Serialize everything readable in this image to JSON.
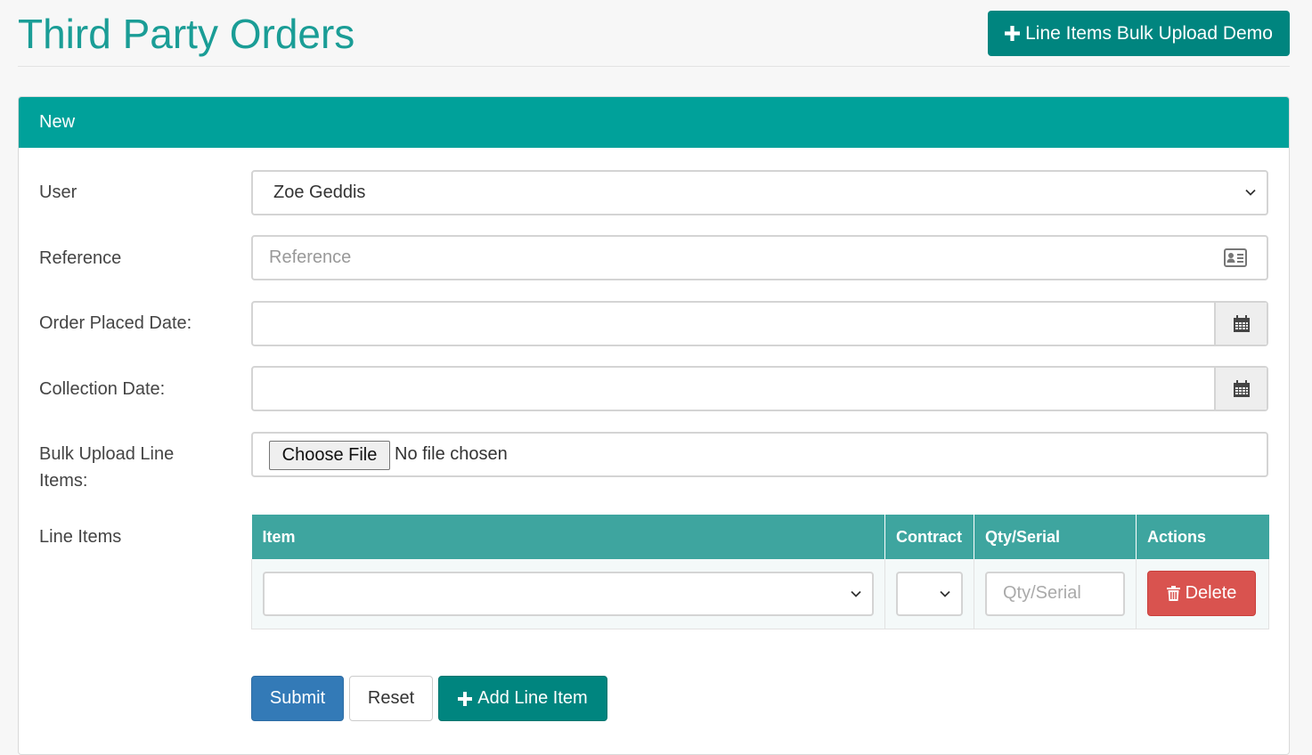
{
  "page": {
    "title": "Third Party Orders",
    "bulk_demo_button": "Line Items Bulk Upload Demo"
  },
  "panel": {
    "heading": "New"
  },
  "form": {
    "user_label": "User",
    "user_value": "Zoe Geddis",
    "reference_label": "Reference",
    "reference_placeholder": "Reference",
    "order_placed_label": "Order Placed Date:",
    "order_placed_value": "",
    "collection_label": "Collection Date:",
    "collection_value": "",
    "bulk_upload_label": "Bulk Upload Line Items:",
    "choose_file_label": "Choose File",
    "file_status": "No file chosen",
    "line_items_label": "Line Items"
  },
  "line_items_table": {
    "columns": [
      "Item",
      "Contract",
      "Qty/Serial",
      "Actions"
    ],
    "rows": [
      {
        "item": "",
        "contract": "",
        "qty_placeholder": "Qty/Serial",
        "delete_label": "Delete"
      }
    ]
  },
  "actions": {
    "submit": "Submit",
    "reset": "Reset",
    "add_line_item": "Add Line Item"
  },
  "colors": {
    "title": "#1a9d96",
    "panel_heading": "#00a19a",
    "table_header": "#3ea59f",
    "teal_button": "#00857f",
    "submit": "#337ab7",
    "delete": "#d9534f"
  },
  "icons": {
    "plus": "plus-icon",
    "id_card": "id-card-icon",
    "calendar": "calendar-icon",
    "chevron": "chevron-down-icon",
    "trash": "trash-icon"
  }
}
